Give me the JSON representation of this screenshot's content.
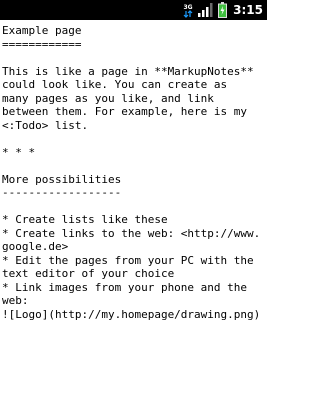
{
  "status_bar": {
    "network_label": "3G",
    "clock": "3:15",
    "colors": {
      "background": "#000000",
      "network": "#1c9cff",
      "battery": "#3fbf3f",
      "text": "#ffffff"
    },
    "icons": [
      "3g-data-icon",
      "signal-strength-icon",
      "battery-charging-icon"
    ]
  },
  "note": {
    "lines": [
      "Example page",
      "============",
      "",
      "This is like a page in **MarkupNotes**",
      "could look like. You can create as",
      "many pages as you like, and link",
      "between them. For example, here is my",
      "<:Todo> list.",
      "",
      "* * *",
      "",
      "More possibilities",
      "------------------",
      "",
      "* Create lists like these",
      "* Create links to the web: <http://www.",
      "google.de>",
      "* Edit the pages from your PC with the",
      "text editor of your choice",
      "* Link images from your phone and the",
      "web:",
      "![Logo](http://my.homepage/drawing.png)"
    ]
  }
}
